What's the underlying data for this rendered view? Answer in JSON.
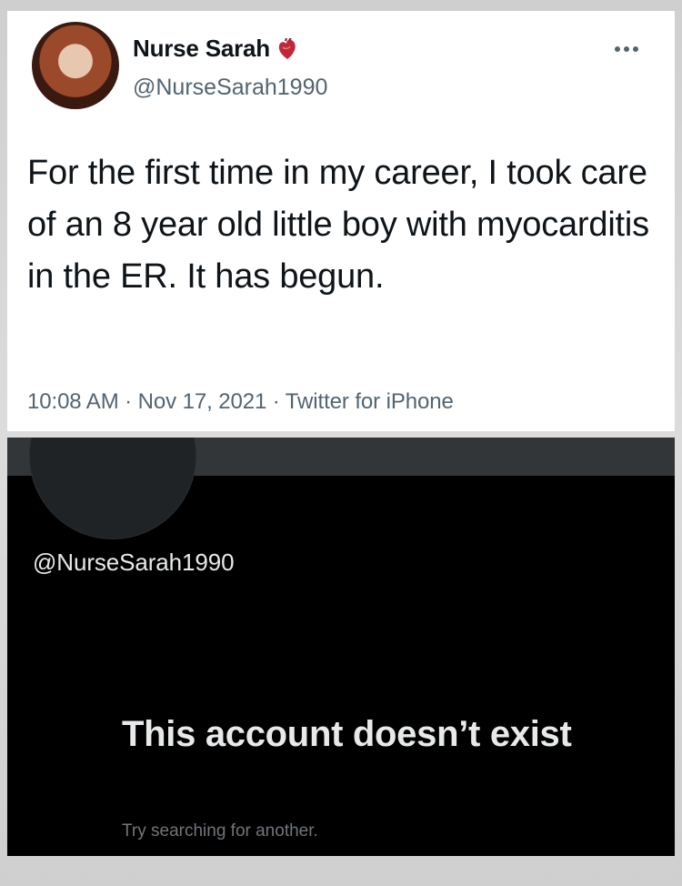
{
  "tweet": {
    "display_name": "Nurse Sarah",
    "handle": "@NurseSarah1990",
    "name_emoji_icon": "anatomical-heart-icon",
    "more_icon": "more-options-icon",
    "text": "For the first time in my career, I took care of an 8 year old little boy with myocarditis in the ER.  It has begun.",
    "timestamp": "10:08 AM · Nov 17, 2021 · Twitter for iPhone"
  },
  "profile": {
    "handle": "@NurseSarah1990",
    "empty_state_title": "This account doesn’t exist",
    "empty_state_subtitle": "Try searching for another."
  },
  "colors": {
    "light_bg": "#ffffff",
    "dark_bg": "#000000",
    "banner": "#333639",
    "text_primary": "#0f1419",
    "text_secondary": "#536471",
    "dark_text": "#e7e9ea",
    "dark_secondary": "#71767b"
  }
}
